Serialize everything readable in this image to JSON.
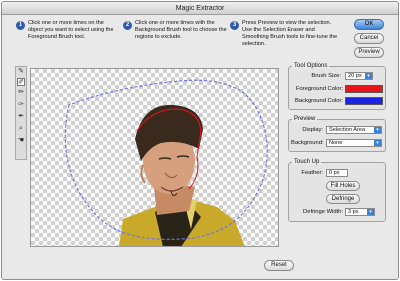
{
  "window": {
    "title": "Magic Extractor"
  },
  "instructions": [
    {
      "num": "1",
      "text": "Click one or more times on the object you want to select using the Foreground Brush tool."
    },
    {
      "num": "2",
      "text": "Click one or more times with the Background Brush tool to choose the regions to exclude."
    },
    {
      "num": "3",
      "text": "Press Preview to view the selection. Use the Selection Eraser and Smoothing Brush tools to fine-tune the selection."
    }
  ],
  "buttons": {
    "ok": "OK",
    "cancel": "Cancel",
    "preview": "Preview",
    "reset": "Reset"
  },
  "tools": [
    {
      "icon": "foreground-brush-icon",
      "glyph": "✎"
    },
    {
      "icon": "background-brush-icon",
      "glyph": "✐"
    },
    {
      "icon": "point-eraser-icon",
      "glyph": "✏"
    },
    {
      "icon": "add-to-selection-icon",
      "glyph": "✑"
    },
    {
      "icon": "smoothing-brush-icon",
      "glyph": "✒"
    },
    {
      "icon": "zoom-icon",
      "glyph": "⌕"
    },
    {
      "icon": "hand-icon",
      "glyph": "☚"
    }
  ],
  "tool_options": {
    "title": "Tool Options",
    "brush_size_label": "Brush Size:",
    "brush_size_value": "20 px",
    "foreground_color_label": "Foreground Color:",
    "foreground_color": "#e8141a",
    "background_color_label": "Background Color:",
    "background_color": "#1a22e6"
  },
  "preview": {
    "title": "Preview",
    "display_label": "Display:",
    "display_value": "Selection Area",
    "background_label": "Background:",
    "background_value": "None"
  },
  "touch_up": {
    "title": "Touch Up",
    "feather_label": "Feather:",
    "feather_value": "0 px",
    "fill_holes": "Fill Holes",
    "defringe": "Defringe",
    "defringe_width_label": "Defringe Width:",
    "defringe_width_value": "3 px"
  },
  "colors": {
    "accent": "#3d82d6",
    "step_badge": "#2f5aa8",
    "selection_outline": "#6f74e8"
  }
}
